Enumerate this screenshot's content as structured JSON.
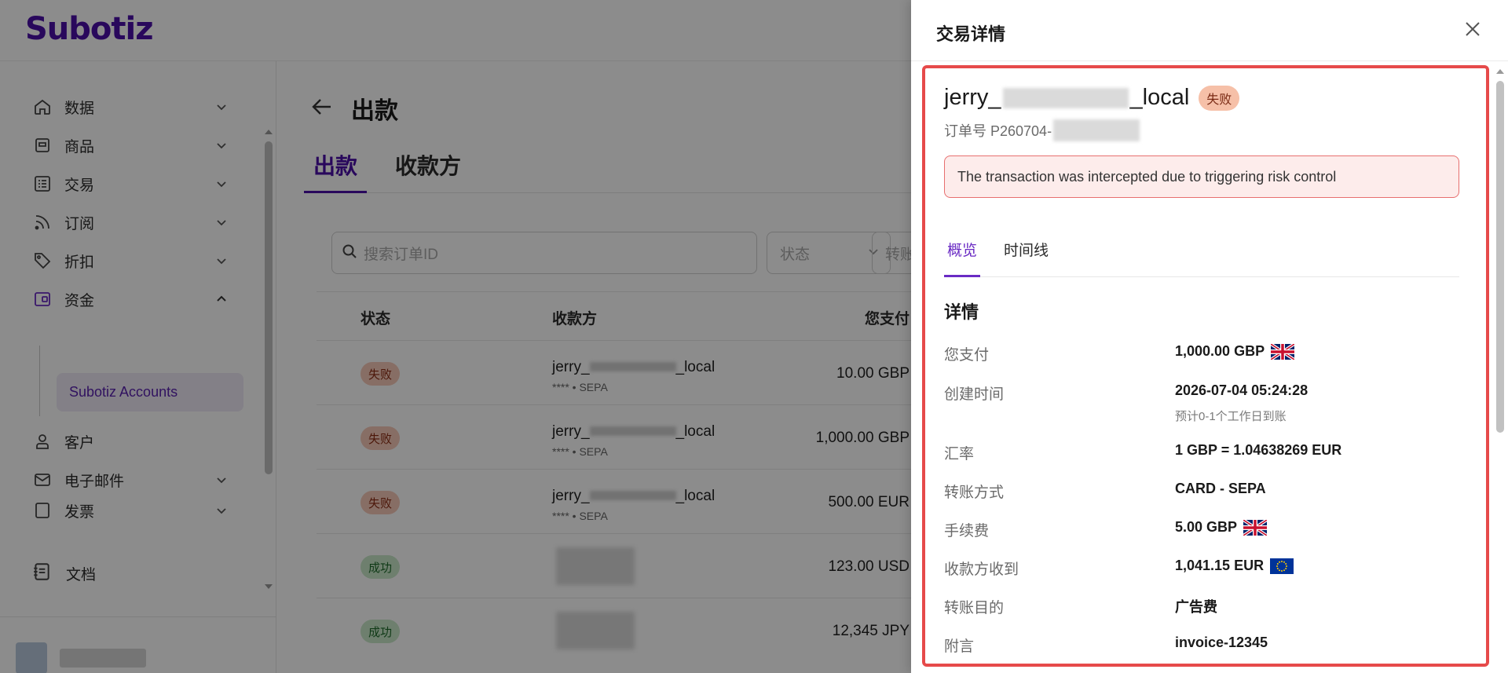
{
  "app": {
    "logo": "Subotiz"
  },
  "sidebar": {
    "items": [
      {
        "label": "数据",
        "icon": "home-icon"
      },
      {
        "label": "商品",
        "icon": "store-icon"
      },
      {
        "label": "交易",
        "icon": "list-icon"
      },
      {
        "label": "订阅",
        "icon": "rss-icon"
      },
      {
        "label": "折扣",
        "icon": "tag-icon"
      },
      {
        "label": "资金",
        "icon": "wallet-icon"
      },
      {
        "label": "客户",
        "icon": "user-icon"
      },
      {
        "label": "电子邮件",
        "icon": "mail-icon"
      },
      {
        "label": "发票",
        "icon": "invoice-icon"
      }
    ],
    "sub_item": "Subotiz Accounts",
    "docs": "文档"
  },
  "main": {
    "title": "出款",
    "tabs": [
      "出款",
      "收款方"
    ],
    "search_placeholder": "搜索订单ID",
    "filter_status": "状态",
    "filter_method": "转账",
    "headers": [
      "状态",
      "收款方",
      "您支付"
    ],
    "rows": [
      {
        "status": "失败",
        "payee": "jerry_",
        "payee_suffix": "_local",
        "sub": "**** • SEPA",
        "amount": "10.00 GBP"
      },
      {
        "status": "失败",
        "payee": "jerry_",
        "payee_suffix": "_local",
        "sub": "**** • SEPA",
        "amount": "1,000.00 GBP"
      },
      {
        "status": "失败",
        "payee": "jerry_",
        "payee_suffix": "_local",
        "sub": "**** • SEPA",
        "amount": "500.00 EUR"
      },
      {
        "status": "成功",
        "payee": "",
        "payee_suffix": "",
        "sub": "",
        "amount": "123.00 USD"
      },
      {
        "status": "成功",
        "payee": "",
        "payee_suffix": "",
        "sub": "",
        "amount": "12,345 JPY"
      }
    ]
  },
  "drawer": {
    "title": "交易详情",
    "payee_prefix": "jerry_",
    "payee_suffix": "_local",
    "status": "失败",
    "order_label": "订单号 P260704-",
    "alert": "The transaction was intercepted due to triggering risk control",
    "tabs": [
      "概览",
      "时间线"
    ],
    "section": "详情",
    "details": [
      {
        "label": "您支付",
        "value": "1,000.00 GBP",
        "flag": "uk-flag-icon"
      },
      {
        "label": "创建时间",
        "value": "2026-07-04 05:24:28",
        "note": "预计0-1个工作日到账"
      },
      {
        "label": "汇率",
        "value": "1 GBP = 1.04638269 EUR"
      },
      {
        "label": "转账方式",
        "value": "CARD - SEPA"
      },
      {
        "label": "手续费",
        "value": "5.00 GBP",
        "flag": "uk-flag-icon"
      },
      {
        "label": "收款方收到",
        "value": "1,041.15 EUR",
        "flag": "eu-flag-icon"
      },
      {
        "label": "转账目的",
        "value": "广告费"
      },
      {
        "label": "附言",
        "value": "invoice-12345"
      }
    ]
  }
}
